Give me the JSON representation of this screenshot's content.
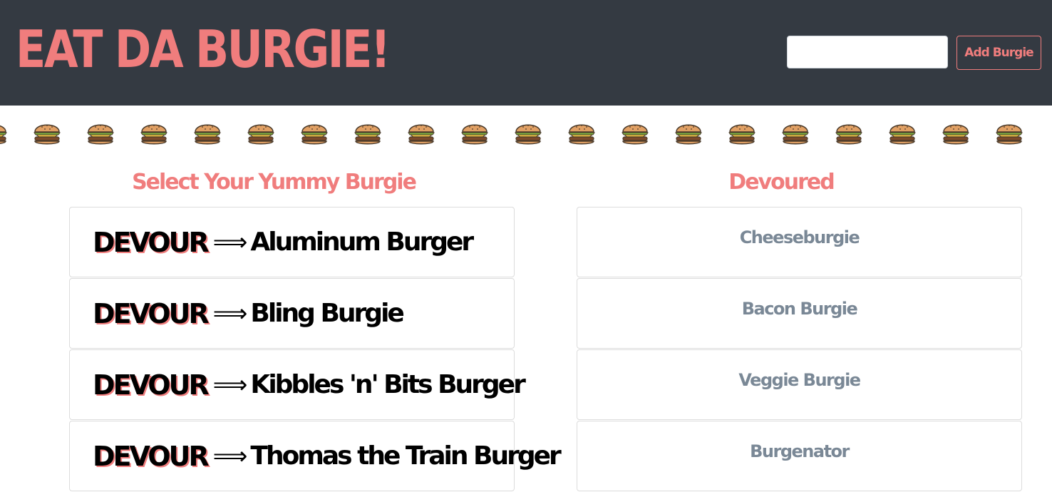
{
  "header": {
    "title": "EAT DA BURGIE!",
    "input_value": "",
    "add_button_label": "Add Burgie",
    "background_color": "#343a42",
    "accent_color": "#f07d7d"
  },
  "decoration": {
    "icon": "burger-icon",
    "repeat_count": 20
  },
  "left_column": {
    "title": "Select Your Yummy Burgie",
    "action_label": "DEVOUR",
    "arrow": "⟹",
    "items": [
      {
        "name": "Aluminum Burger"
      },
      {
        "name": "Bling Burgie"
      },
      {
        "name": "Kibbles 'n' Bits Burger"
      },
      {
        "name": "Thomas the Train Burger"
      }
    ]
  },
  "right_column": {
    "title": "Devoured",
    "items": [
      {
        "name": "Cheeseburgie"
      },
      {
        "name": "Bacon Burgie"
      },
      {
        "name": "Veggie Burgie"
      },
      {
        "name": "Burgenator"
      }
    ]
  }
}
